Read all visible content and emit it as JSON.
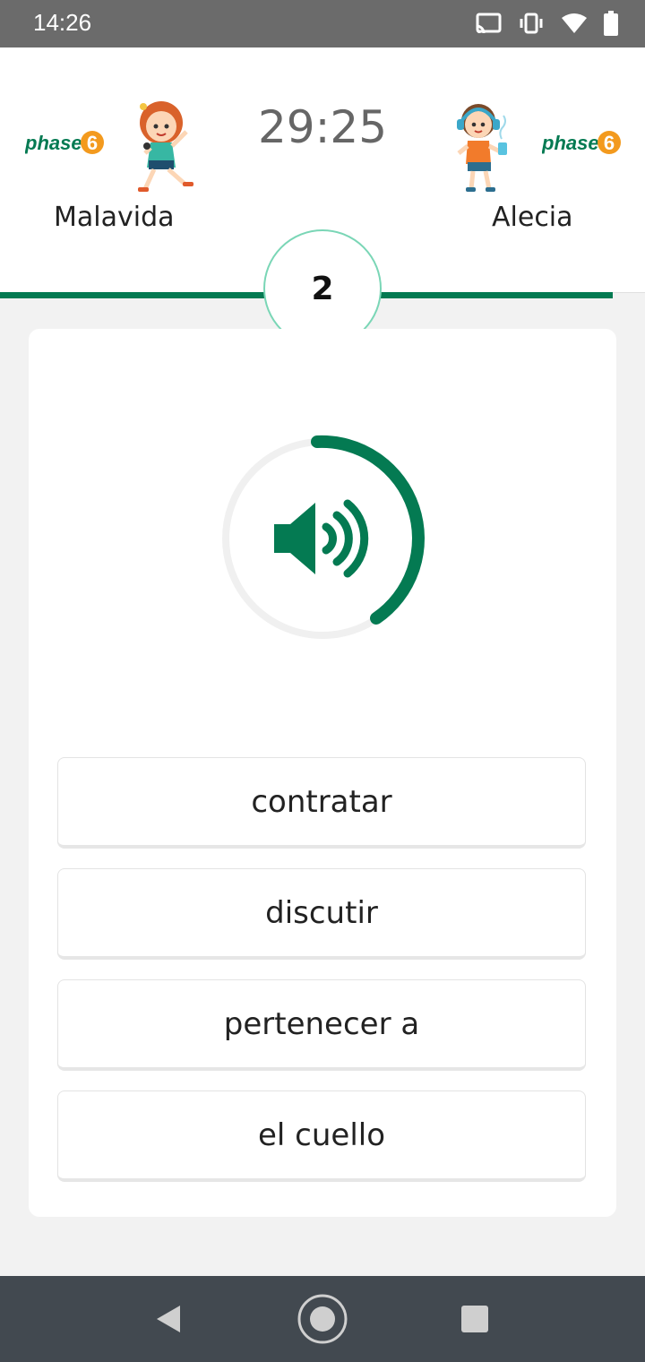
{
  "status_bar": {
    "time": "14:26",
    "icons": [
      "cast-icon",
      "vibrate-icon",
      "wifi-icon",
      "battery-icon"
    ]
  },
  "header": {
    "timer": "29:25",
    "round": "2",
    "players": [
      {
        "name": "Malavida",
        "logo_text": "phase",
        "logo_digit": "6"
      },
      {
        "name": "Alecia",
        "logo_text": "phase",
        "logo_digit": "6"
      }
    ]
  },
  "quiz": {
    "audio_icon": "speaker-icon",
    "options": [
      "contratar",
      "discutir",
      "pertenecer a",
      "el cuello"
    ]
  },
  "colors": {
    "accent": "#047a52",
    "logo_orange": "#f39a1e",
    "status_bar": "#6b6b6b",
    "nav_bar": "#424950"
  },
  "nav": {
    "icons": [
      "back-icon",
      "home-icon",
      "recents-icon"
    ]
  }
}
